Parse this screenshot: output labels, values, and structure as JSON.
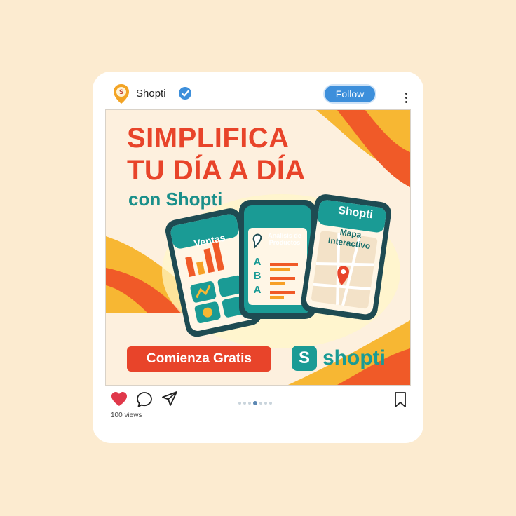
{
  "post": {
    "username": "Shopti",
    "follow_label": "Follow",
    "views": "100 views",
    "carousel": {
      "count": 7,
      "active_index": 3
    },
    "liked": true
  },
  "creative": {
    "headline_line1": "SIMPLIFICA",
    "headline_line2": "TU DÍA A DÍA",
    "subheadline": "con Shopti",
    "phone1_title": "Ventas",
    "phone2_title": "Análisis de Productos",
    "phone2_rows": [
      "A",
      "B",
      "A"
    ],
    "phone3_brand": "Shopti",
    "phone3_title": "Mapa Interactivo",
    "cta": "Comienza Gratis",
    "logo_letter": "S",
    "logo_text": "shopti"
  },
  "colors": {
    "background": "#fcebd0",
    "follow": "#3d8fdb",
    "accent_red": "#e8442a",
    "teal": "#1a9b95",
    "like": "#e0384a"
  },
  "icons": [
    "avatar-logo-icon",
    "verified-icon",
    "more-icon",
    "heart-icon",
    "comment-icon",
    "share-icon",
    "bookmark-icon",
    "map-pin-icon"
  ]
}
